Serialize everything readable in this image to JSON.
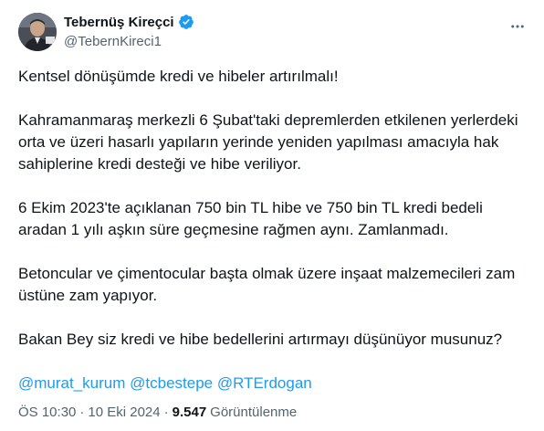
{
  "author": {
    "display_name": "Tebernüş Kireçci",
    "handle": "@TebernKireci1",
    "verified": true,
    "verified_color": "#1d9bf0",
    "avatar_icon": "profile-photo"
  },
  "more_icon": "ellipsis-icon",
  "tweet": {
    "paragraphs": [
      "Kentsel dönüşümde kredi ve hibeler artırılmalı!",
      "Kahramanmaraş merkezli 6 Şubat'taki depremlerden etkilenen yerlerdeki orta ve üzeri hasarlı yapıların yerinde yeniden yapılması amacıyla hak sahiplerine kredi desteği ve hibe veriliyor.",
      "6 Ekim 2023'te açıklanan 750 bin TL hibe ve 750 bin TL kredi bedeli aradan 1 yılı aşkın süre geçmesine rağmen aynı. Zamlanmadı.",
      "Betoncular ve çimentocular başta olmak üzere inşaat malzemecileri zam üstüne zam yapıyor.",
      "Bakan Bey siz kredi ve hibe bedellerini artırmayı düşünüyor musunuz?"
    ],
    "mentions": [
      "@murat_kurum",
      "@tcbestepe",
      "@RTErdogan"
    ],
    "link_color": "#1d9bf0"
  },
  "meta": {
    "time": "ÖS 10:30",
    "separator": "·",
    "date": "10 Eki 2024",
    "views_count": "9.547",
    "views_label": "Görüntülenme"
  }
}
